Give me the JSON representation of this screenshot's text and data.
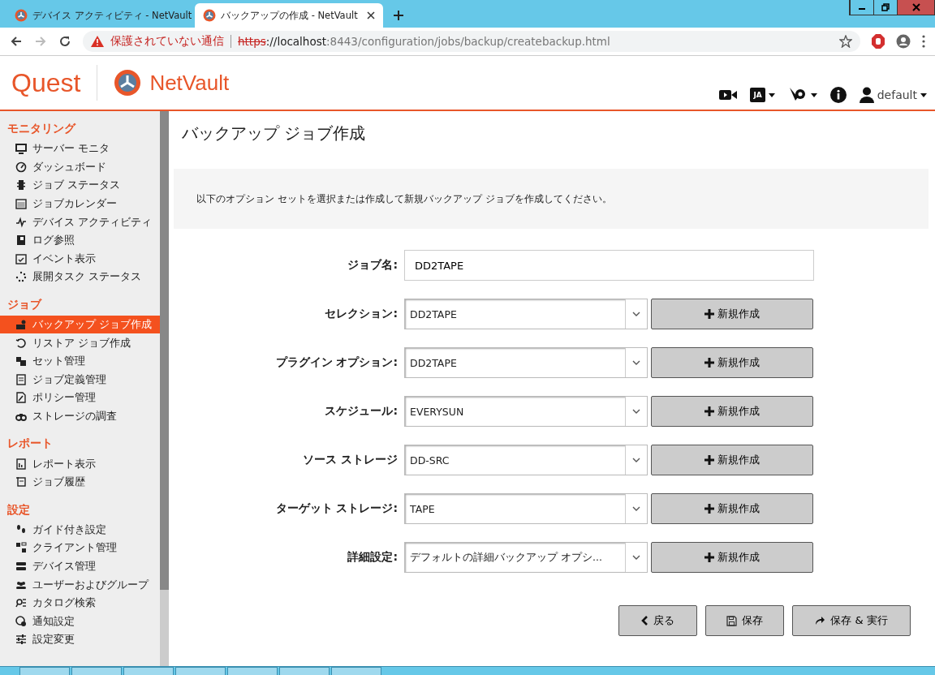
{
  "browser": {
    "tabs": [
      {
        "title": "デバイス アクティビティ - NetVault",
        "selected": false
      },
      {
        "title": "バックアップの作成 - NetVault",
        "selected": true
      }
    ],
    "security_warning": "保護されていない通信",
    "url_scheme": "https",
    "url_host": "://localhost",
    "url_rest": ":8443/configuration/jobs/backup/createbackup.html"
  },
  "header": {
    "brand": "Quest",
    "product": "NetVault",
    "language": "JA",
    "user": "default"
  },
  "sidebar": {
    "sections": [
      {
        "title": "モニタリング",
        "items": [
          {
            "label": "サーバー モニタ",
            "selected": false
          },
          {
            "label": "ダッシュボード",
            "selected": false
          },
          {
            "label": "ジョブ ステータス",
            "selected": false
          },
          {
            "label": "ジョブカレンダー",
            "selected": false
          },
          {
            "label": "デバイス アクティビティ",
            "selected": false
          },
          {
            "label": "ログ参照",
            "selected": false
          },
          {
            "label": "イベント表示",
            "selected": false
          },
          {
            "label": "展開タスク ステータス",
            "selected": false
          }
        ]
      },
      {
        "title": "ジョブ",
        "items": [
          {
            "label": "バックアップ ジョブ作成",
            "selected": true
          },
          {
            "label": "リストア ジョブ作成",
            "selected": false
          },
          {
            "label": "セット管理",
            "selected": false
          },
          {
            "label": "ジョブ定義管理",
            "selected": false
          },
          {
            "label": "ポリシー管理",
            "selected": false
          },
          {
            "label": "ストレージの調査",
            "selected": false
          }
        ]
      },
      {
        "title": "レポート",
        "items": [
          {
            "label": "レポート表示",
            "selected": false
          },
          {
            "label": "ジョブ履歴",
            "selected": false
          }
        ]
      },
      {
        "title": "設定",
        "items": [
          {
            "label": "ガイド付き設定",
            "selected": false
          },
          {
            "label": "クライアント管理",
            "selected": false
          },
          {
            "label": "デバイス管理",
            "selected": false
          },
          {
            "label": "ユーザーおよびグループ",
            "selected": false
          },
          {
            "label": "カタログ検索",
            "selected": false
          },
          {
            "label": "通知設定",
            "selected": false
          },
          {
            "label": "設定変更",
            "selected": false
          }
        ]
      }
    ]
  },
  "page": {
    "title": "バックアップ ジョブ作成",
    "info": "以下のオプション セットを選択または作成して新規バックアップ ジョブを作成してください。",
    "fields": [
      {
        "kind": "text",
        "label": "ジョブ名:",
        "value": "DD2TAPE"
      },
      {
        "kind": "select",
        "label": "セレクション:",
        "value": "DD2TAPE",
        "button": "新規作成"
      },
      {
        "kind": "select",
        "label": "プラグイン オプション:",
        "value": "DD2TAPE",
        "button": "新規作成"
      },
      {
        "kind": "select",
        "label": "スケジュール:",
        "value": "EVERYSUN",
        "button": "新規作成"
      },
      {
        "kind": "select",
        "label": "ソース ストレージ",
        "value": "DD-SRC",
        "button": "新規作成"
      },
      {
        "kind": "select",
        "label": "ターゲット ストレージ:",
        "value": "TAPE",
        "button": "新規作成"
      },
      {
        "kind": "select",
        "label": "詳細設定:",
        "value": "デフォルトの詳細バックアップ オプシ...",
        "button": "新規作成"
      }
    ],
    "actions": [
      {
        "kind": "back",
        "label": "戻る"
      },
      {
        "kind": "save",
        "label": "保存"
      },
      {
        "kind": "run",
        "label": "保存 & 実行"
      }
    ]
  }
}
